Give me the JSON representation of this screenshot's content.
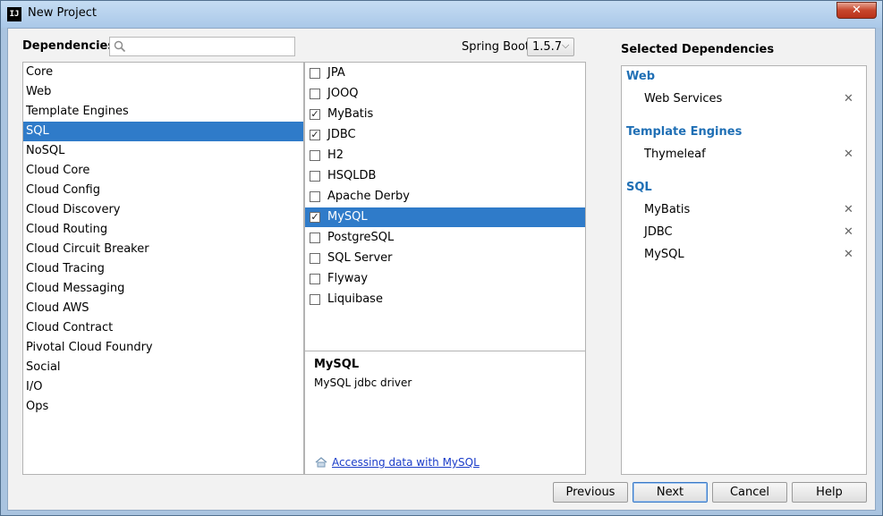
{
  "window": {
    "title": "New Project",
    "app_icon_text": "IJ"
  },
  "header": {
    "dependencies_label": "Dependencies",
    "search_value": "",
    "spring_boot_label": "Spring Boot",
    "spring_boot_version": "1.5.7"
  },
  "categories": [
    {
      "label": "Core",
      "selected": false
    },
    {
      "label": "Web",
      "selected": false
    },
    {
      "label": "Template Engines",
      "selected": false
    },
    {
      "label": "SQL",
      "selected": true
    },
    {
      "label": "NoSQL",
      "selected": false
    },
    {
      "label": "Cloud Core",
      "selected": false
    },
    {
      "label": "Cloud Config",
      "selected": false
    },
    {
      "label": "Cloud Discovery",
      "selected": false
    },
    {
      "label": "Cloud Routing",
      "selected": false
    },
    {
      "label": "Cloud Circuit Breaker",
      "selected": false
    },
    {
      "label": "Cloud Tracing",
      "selected": false
    },
    {
      "label": "Cloud Messaging",
      "selected": false
    },
    {
      "label": "Cloud AWS",
      "selected": false
    },
    {
      "label": "Cloud Contract",
      "selected": false
    },
    {
      "label": "Pivotal Cloud Foundry",
      "selected": false
    },
    {
      "label": "Social",
      "selected": false
    },
    {
      "label": "I/O",
      "selected": false
    },
    {
      "label": "Ops",
      "selected": false
    }
  ],
  "dependencies": [
    {
      "label": "JPA",
      "checked": false,
      "selected": false
    },
    {
      "label": "JOOQ",
      "checked": false,
      "selected": false
    },
    {
      "label": "MyBatis",
      "checked": true,
      "selected": false
    },
    {
      "label": "JDBC",
      "checked": true,
      "selected": false
    },
    {
      "label": "H2",
      "checked": false,
      "selected": false
    },
    {
      "label": "HSQLDB",
      "checked": false,
      "selected": false
    },
    {
      "label": "Apache Derby",
      "checked": false,
      "selected": false
    },
    {
      "label": "MySQL",
      "checked": true,
      "selected": true
    },
    {
      "label": "PostgreSQL",
      "checked": false,
      "selected": false
    },
    {
      "label": "SQL Server",
      "checked": false,
      "selected": false
    },
    {
      "label": "Flyway",
      "checked": false,
      "selected": false
    },
    {
      "label": "Liquibase",
      "checked": false,
      "selected": false
    }
  ],
  "description": {
    "title": "MySQL",
    "text": "MySQL jdbc driver",
    "link": "Accessing data with MySQL"
  },
  "selected": {
    "title": "Selected Dependencies",
    "remove_glyph": "✕",
    "groups": [
      {
        "name": "Web",
        "items": [
          "Web Services"
        ]
      },
      {
        "name": "Template Engines",
        "items": [
          "Thymeleaf"
        ]
      },
      {
        "name": "SQL",
        "items": [
          "MyBatis",
          "JDBC",
          "MySQL"
        ]
      }
    ]
  },
  "buttons": {
    "previous": "Previous",
    "next": "Next",
    "cancel": "Cancel",
    "help": "Help"
  },
  "colors": {
    "selection": "#2f7bc9",
    "group_heading": "#1f6fb5",
    "link": "#1a3cc9"
  }
}
